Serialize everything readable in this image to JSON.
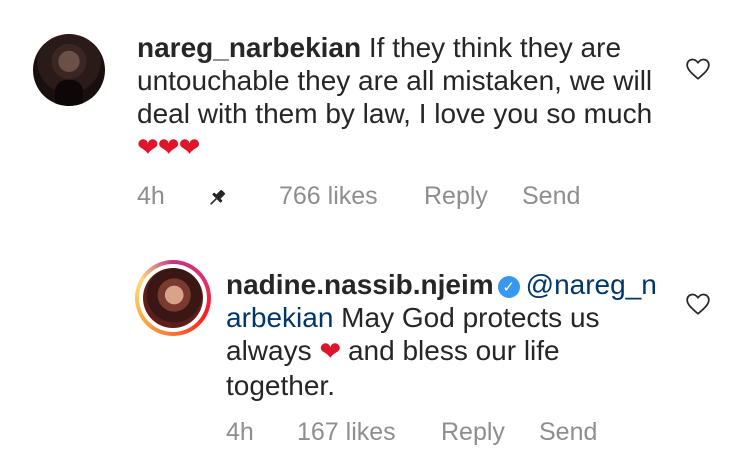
{
  "comments": [
    {
      "username": "nareg_narbekian",
      "text": " If they think they are untouchable they are all mistaken, we will deal with them by law, I love you so much ",
      "emoji": "❤❤❤",
      "time": "4h",
      "likes": "766 likes",
      "reply_label": "Reply",
      "send_label": "Send"
    },
    {
      "username": "nadine.nassib.njeim",
      "verified_mark": "✓",
      "mention": "@nareg_narbekian",
      "text_before_emoji": " May God protects us  always ",
      "emoji": "❤",
      "text_after_emoji": " and bless our life together.",
      "time": "4h",
      "likes": "167 likes",
      "reply_label": "Reply",
      "send_label": "Send"
    }
  ],
  "icons": {
    "like": "heart-outline-icon",
    "pin": "pin-icon",
    "verified": "verified-badge-icon"
  },
  "colors": {
    "text": "#262626",
    "meta": "#8e8e8e",
    "mention": "#00376b",
    "verified": "#3897f0",
    "heart": "#e0142a"
  }
}
